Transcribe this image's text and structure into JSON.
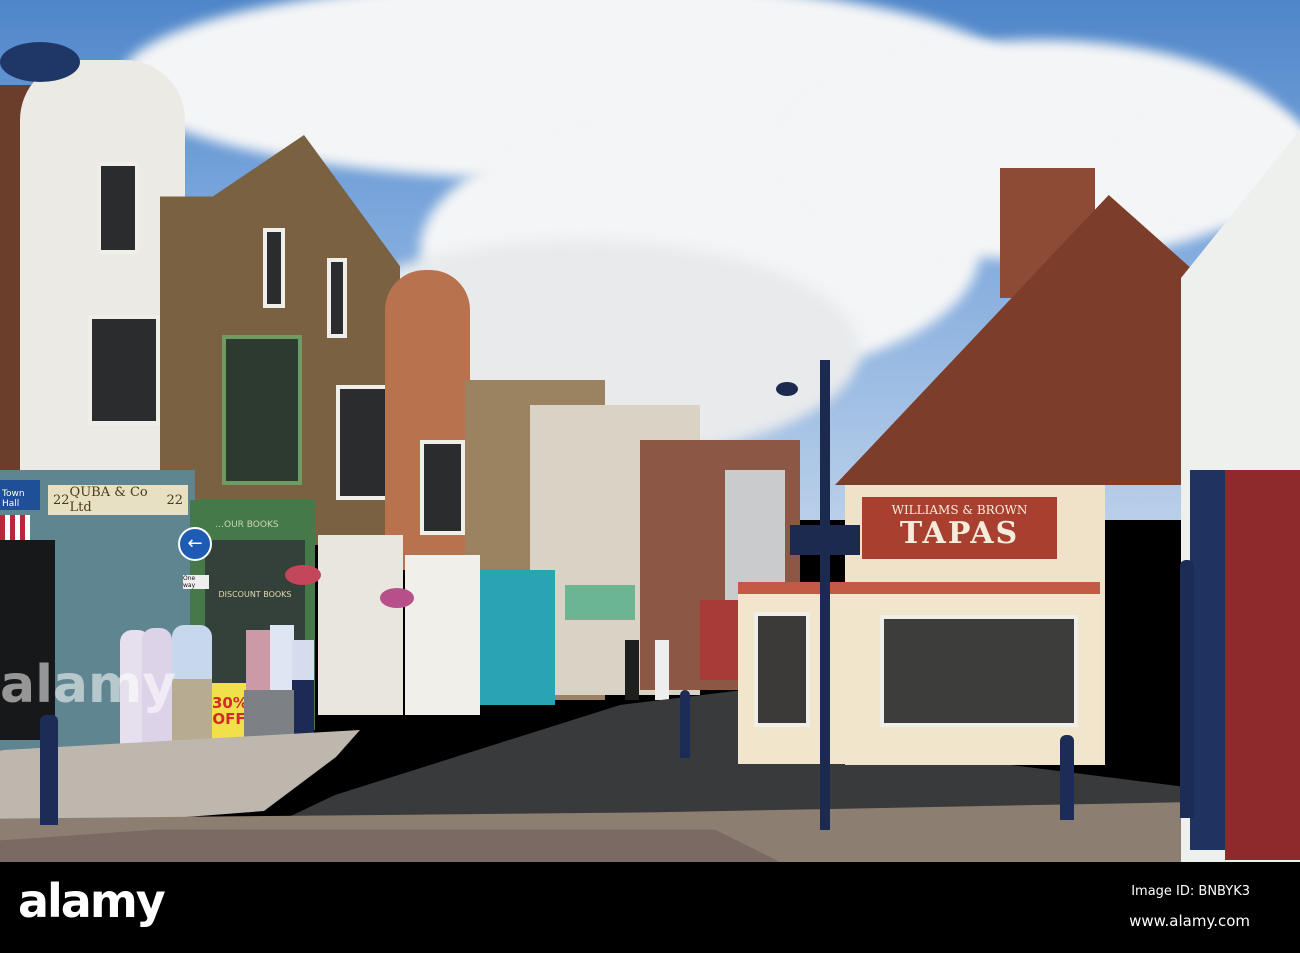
{
  "signs": {
    "quba_number_left": "22",
    "quba_name": "QUBA & Co Ltd",
    "quba_number_right": "22",
    "bookshop_name": "…OUR BOOKS",
    "bookshop_window": "DISCOUNT BOOKS",
    "one_way": "One way",
    "town_hall": "Town Hall",
    "sale_board": "30% OFF",
    "tapas_subtitle": "WILLIAMS & BROWN",
    "tapas_title": "TAPAS"
  },
  "watermark": {
    "overlay_text": "alamy",
    "logo": "alamy",
    "image_id": "Image ID: BNBYK3",
    "url": "www.alamy.com"
  }
}
